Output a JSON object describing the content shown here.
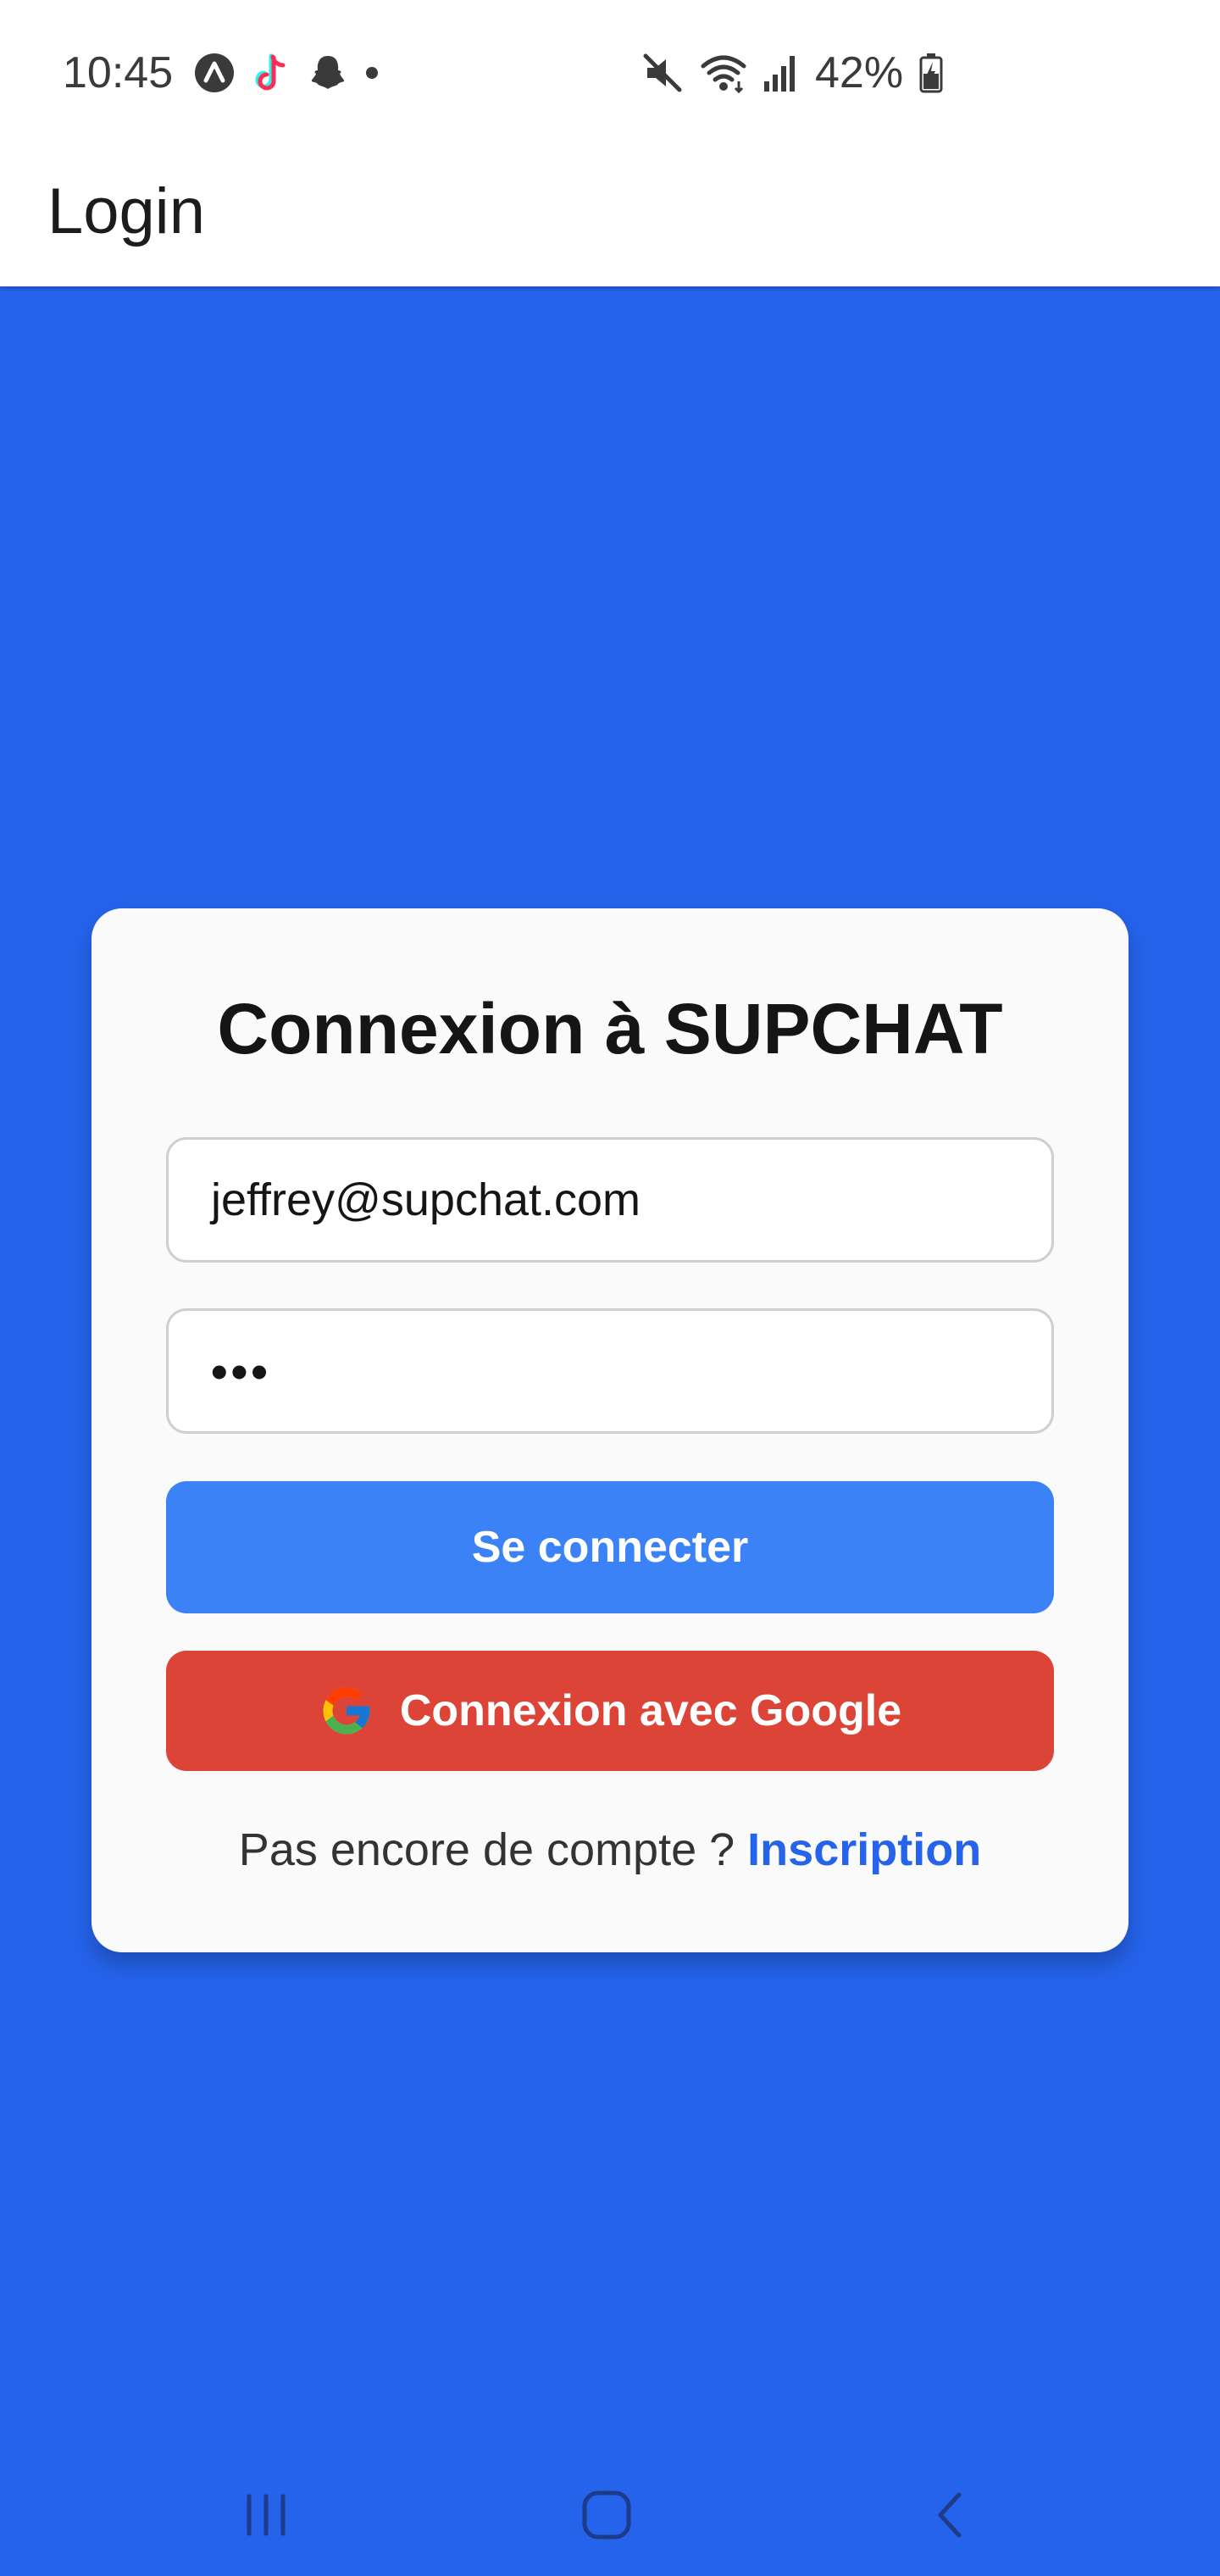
{
  "status_bar": {
    "time": "10:45",
    "battery": "42%",
    "left_icons": [
      "a-badge-icon",
      "tiktok-icon",
      "snapchat-icon",
      "dot-icon"
    ],
    "right_icons": [
      "mute-icon",
      "wifi-icon",
      "signal-icon",
      "battery-icon"
    ]
  },
  "app_bar": {
    "title": "Login"
  },
  "login_card": {
    "title": "Connexion à SUPCHAT",
    "email_value": "jeffrey@supchat.com",
    "password_value": "•••",
    "login_button": "Se connecter",
    "google_button": "Connexion avec Google",
    "signup_prompt": "Pas encore de compte ?",
    "signup_link": "Inscription"
  },
  "colors": {
    "background": "#2563EB",
    "login_button": "#3B82F6",
    "google_button": "#DB4437",
    "link": "#2563EB"
  },
  "nav_bar": {
    "buttons": [
      "recents-icon",
      "home-icon",
      "back-icon"
    ]
  }
}
